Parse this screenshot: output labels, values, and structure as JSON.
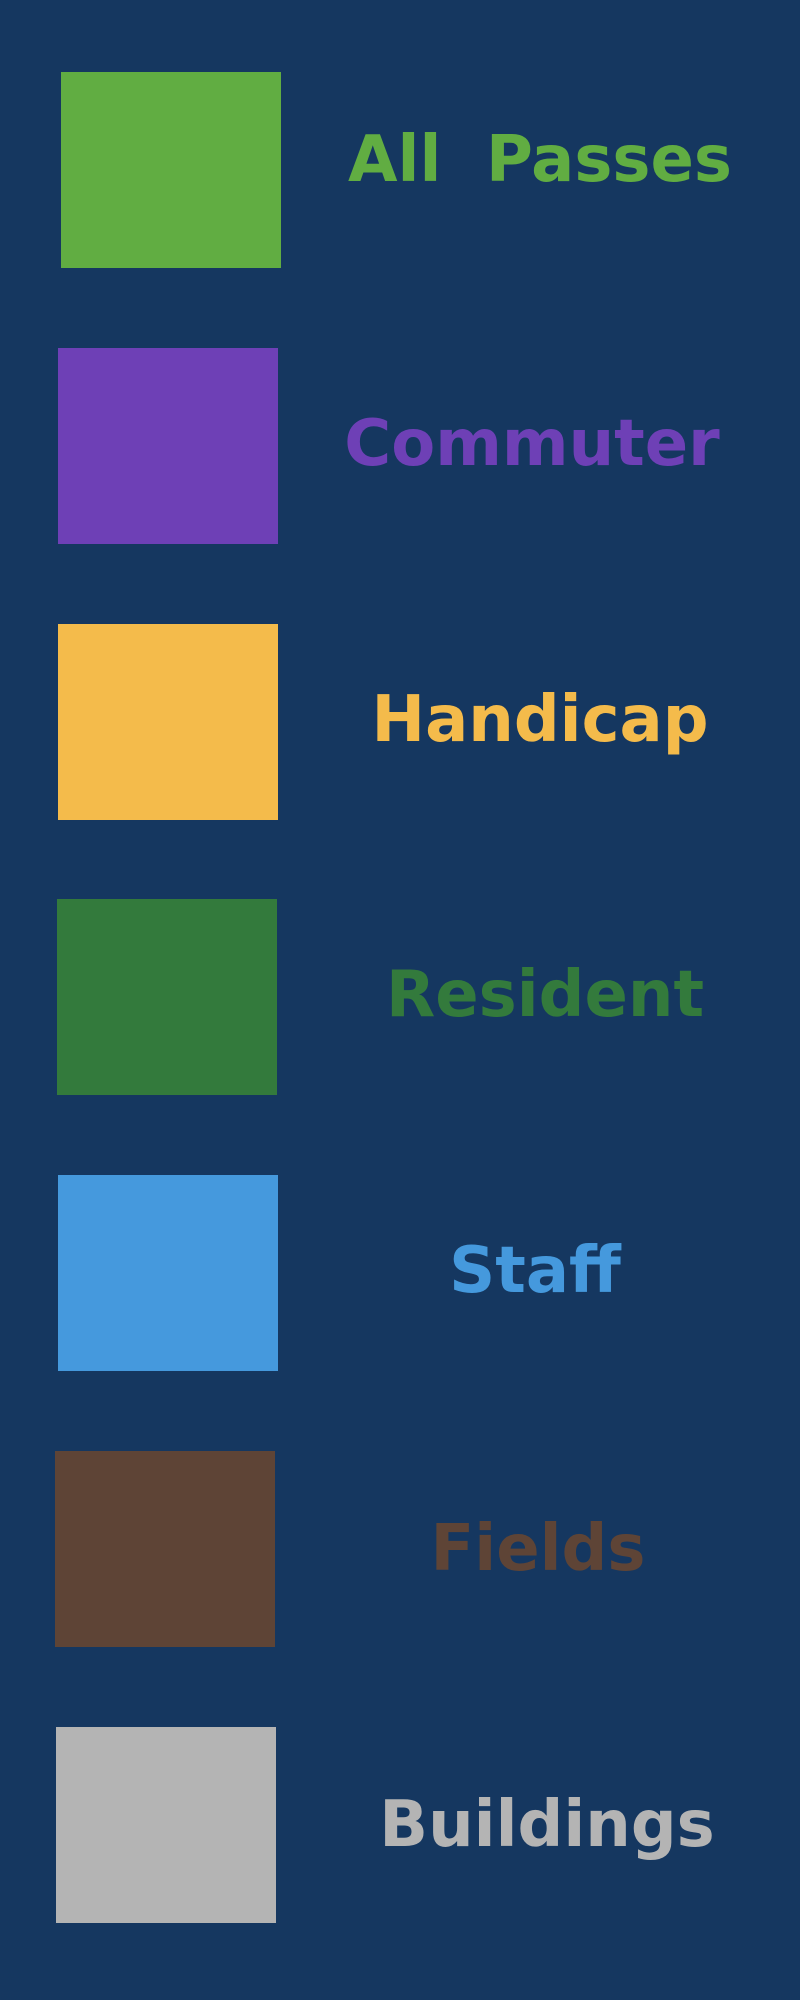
{
  "legend": {
    "items": [
      {
        "label": "All  Passes",
        "color": "#61ad42"
      },
      {
        "label": "Commuter",
        "color": "#6e40b6"
      },
      {
        "label": "Handicap",
        "color": "#f4bb4b"
      },
      {
        "label": "Resident",
        "color": "#337a3c"
      },
      {
        "label": "Staff",
        "color": "#4599dd"
      },
      {
        "label": "Fields",
        "color": "#5e4436"
      },
      {
        "label": "Buildings",
        "color": "#b4b4b4"
      }
    ]
  }
}
